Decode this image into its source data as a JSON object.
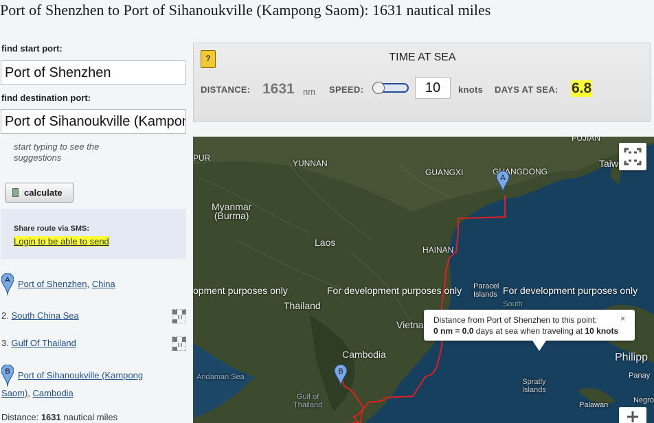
{
  "title": "Port of Shenzhen to Port of Sihanoukville (Kampong Saom): 1631 nautical miles",
  "left": {
    "start_label": "find start port:",
    "start_value": "Port of Shenzhen",
    "dest_label": "find destination port:",
    "dest_value": "Port of Sihanoukville (Kampong Saom)",
    "hint": "start typing to see the suggestions",
    "calculate_label": "calculate",
    "sms_title": "Share route via SMS:",
    "sms_link": "Login to be able to send",
    "route": [
      {
        "marker": "A",
        "port": "Port of Shenzhen",
        "country": "China"
      },
      {
        "index": "2.",
        "name": "South China Sea"
      },
      {
        "index": "3.",
        "name": "Gulf Of Thailand"
      },
      {
        "marker": "B",
        "port_line1": "Port of Sihanoukville (Kampong",
        "port_line2": "Saom)",
        "country": "Cambodia"
      }
    ],
    "distance_label": "Distance:",
    "distance_value": "1631",
    "distance_unit": "nautical miles"
  },
  "panel": {
    "help_icon": "?",
    "title": "TIME AT SEA",
    "distance_label": "DISTANCE:",
    "distance_value": "1631",
    "distance_unit": "nm",
    "speed_label": "SPEED:",
    "speed_value": "10",
    "speed_unit": "knots",
    "days_label": "DAYS AT SEA:",
    "days_value": "6.8"
  },
  "map": {
    "labels": {
      "fujian": "FUJIAN",
      "pur": "PUR",
      "yunnan": "YUNNAN",
      "guangxi": "GUANGXI",
      "guangdong": "GUANGDONG",
      "taiwan": "Taiw",
      "myanmar": "Myanmar\n(Burma)",
      "laos": "Laos",
      "hainan": "HAINAN",
      "thailand": "Thailand",
      "paracel": "Paracel\nIslands",
      "south": "South",
      "vietnam": "Vietna",
      "cambodia": "Cambodia",
      "philippines": "Philipp",
      "panay": "Panay",
      "andaman": "Andaman Sea",
      "gulf_thailand": "Gulf of\nThailand",
      "spratly": "Spratly\nIslands",
      "palawan": "Palawan",
      "negros": "Negro"
    },
    "dev_text": "For development purposes only",
    "dev_text_partial": "opment purposes only",
    "marker_a": "A",
    "marker_b": "B",
    "tooltip": {
      "line1": "Distance from Port of Shenzhen to this point:",
      "nm_value": "0 nm = 0.0",
      "mid": " days at sea when traveling at ",
      "knots_value": "10 knots",
      "close": "×"
    },
    "route_color": "#e02020"
  }
}
